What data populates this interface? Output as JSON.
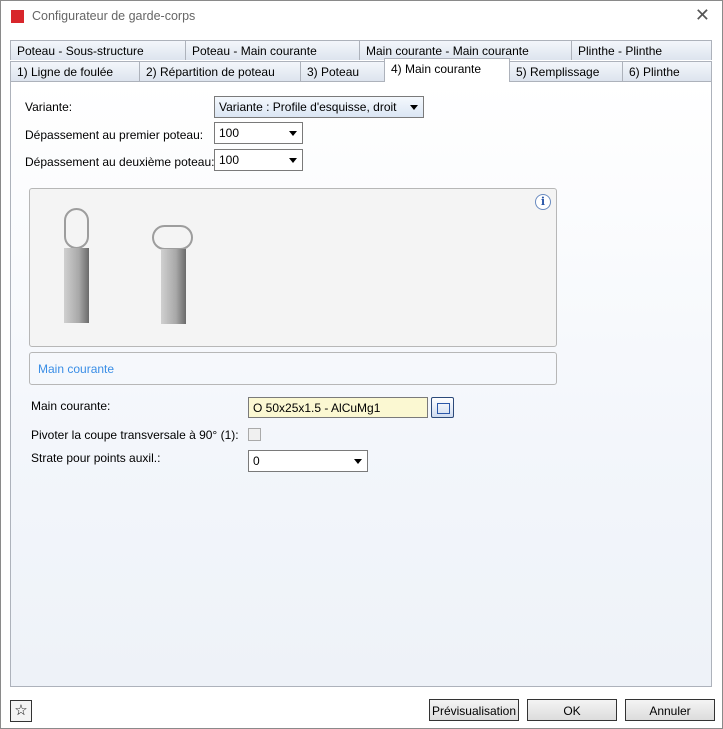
{
  "window": {
    "title": "Configurateur de garde-corps",
    "close_icon": "close-icon"
  },
  "tabs_row1": [
    {
      "label": "Poteau - Sous-structure"
    },
    {
      "label": "Poteau - Main courante"
    },
    {
      "label": "Main courante - Main courante"
    },
    {
      "label": "Plinthe - Plinthe"
    }
  ],
  "tabs_row2": [
    {
      "label": "1) Ligne de foulée"
    },
    {
      "label": "2) Répartition de poteau"
    },
    {
      "label": "3) Poteau"
    },
    {
      "label": "4) Main courante",
      "active": true
    },
    {
      "label": "5) Remplissage"
    },
    {
      "label": "6) Plinthe"
    }
  ],
  "form": {
    "variante_label": "Variante:",
    "variante_value": "Variante : Profile d'esquisse, droit",
    "dep1_label": "Dépassement au premier poteau:",
    "dep1_value": "100",
    "dep2_label": "Dépassement au deuxième poteau:",
    "dep2_value": "100",
    "group_title": "Main courante",
    "main_label": "Main courante:",
    "main_value": "O 50x25x1.5 - AlCuMg1",
    "pivot_label": "Pivoter la coupe transversale à 90° (1):",
    "pivot_checked": false,
    "strate_label": "Strate pour points auxil.:",
    "strate_value": "0"
  },
  "buttons": {
    "preview": "Prévisualisation",
    "ok": "OK",
    "cancel": "Annuler"
  }
}
